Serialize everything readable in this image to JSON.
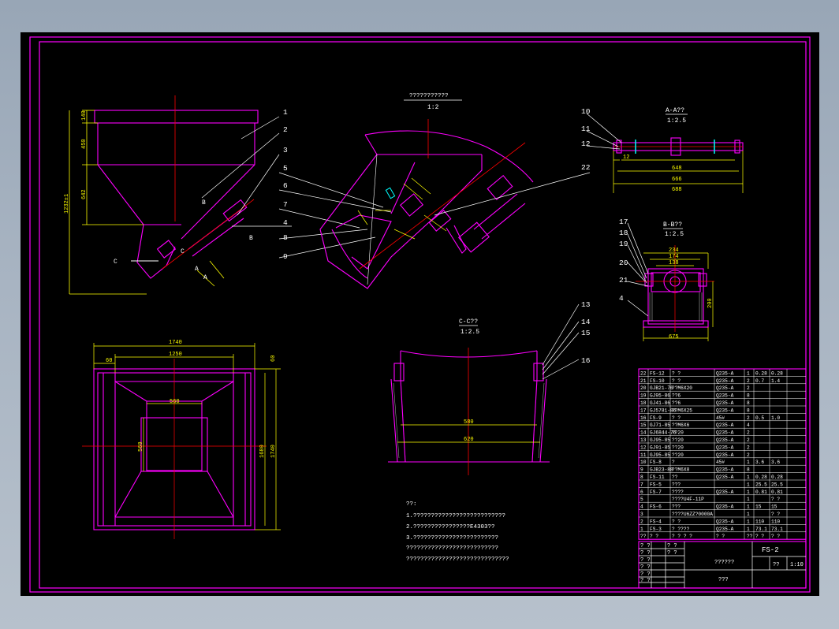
{
  "drawing": {
    "colors": {
      "frame": "#ff00ff",
      "outline": "#ff00ff",
      "dimension": "#ffff00",
      "centerline": "#ff0000",
      "hatch": "#ffffff",
      "text": "#ffffff",
      "accent": "#00ffff"
    },
    "views": {
      "main_title": "???????????",
      "main_scale": "1:2",
      "section_aa_title": "A-A??",
      "section_aa_scale": "1:2.5",
      "section_bb_title": "B-B??",
      "section_bb_scale": "1:2.5",
      "section_cc_title": "C-C??",
      "section_cc_scale": "1:2.5"
    },
    "dimensions": {
      "left_140": "140",
      "left_450": "450",
      "left_642": "642",
      "left_total": "1232±1",
      "aa_12": "12",
      "aa_648": "648",
      "aa_666": "666",
      "aa_688": "688",
      "bb_234": "234",
      "bb_174": "174",
      "bb_138": "138",
      "bb_200": "200",
      "bb_675": "675",
      "plan_1740_top": "1740",
      "plan_1250": "1250",
      "plan_60": "60",
      "plan_560a": "560",
      "plan_560b": "560",
      "plan_1680": "1680",
      "plan_1740_side": "1740",
      "plan_60_side": "60",
      "cc_580": "580",
      "cc_620": "620"
    },
    "balloons": {
      "left_side": [
        "1",
        "2",
        "3",
        "5",
        "6",
        "7",
        "4",
        "8",
        "9"
      ],
      "right_aa": [
        "10",
        "11",
        "12"
      ],
      "right_main": "22",
      "bb": [
        "17",
        "18",
        "19",
        "20",
        "21",
        "4"
      ],
      "cc": [
        "13",
        "14",
        "15",
        "16"
      ]
    },
    "view_letters": {
      "b_label": "B",
      "c_left": "C",
      "c_right": "C",
      "a_right": "A",
      "a_left": "A",
      "b_view": "B"
    },
    "notes": {
      "heading": "??:",
      "line1": "1.??????????????????????????",
      "line2": "2.????????????????E4303??",
      "line3": "3.????????????????????????",
      "line4": "??????????????????????????",
      "line5": "?????????????????????????????"
    },
    "bom_rows": [
      {
        "no": "22",
        "code": "FS-12",
        "name": "? ?",
        "mat": "Q235-A",
        "qty": "1",
        "w1": "0.28",
        "w2": "0.28"
      },
      {
        "no": "21",
        "code": "FS-10",
        "name": "? ?",
        "mat": "Q235-A",
        "qty": "2",
        "w1": "0.7",
        "w2": "1.4"
      },
      {
        "no": "20",
        "code": "GJB21-76",
        "name": "??M6X20",
        "mat": "Q235-A",
        "qty": "2",
        "w1": "",
        "w2": ""
      },
      {
        "no": "19",
        "code": "GJ95-86",
        "name": "??6",
        "mat": "Q235-A",
        "qty": "8",
        "w1": "",
        "w2": ""
      },
      {
        "no": "18",
        "code": "GJ41-86",
        "name": "??6",
        "mat": "Q235-A",
        "qty": "8",
        "w1": "",
        "w2": ""
      },
      {
        "no": "17",
        "code": "GJ5781-86",
        "name": "??M6X25",
        "mat": "Q235-A",
        "qty": "8",
        "w1": "",
        "w2": ""
      },
      {
        "no": "16",
        "code": "FS-9",
        "name": "? ?",
        "mat": "45#",
        "qty": "2",
        "w1": "0.5",
        "w2": "1.0"
      },
      {
        "no": "15",
        "code": "GJ71-85",
        "name": "??M6X6",
        "mat": "Q235-A",
        "qty": "4",
        "w1": "",
        "w2": ""
      },
      {
        "no": "14",
        "code": "GJ6844-76",
        "name": "??20",
        "mat": "Q235-A",
        "qty": "2",
        "w1": "",
        "w2": ""
      },
      {
        "no": "13",
        "code": "GJ95-85",
        "name": "??20",
        "mat": "Q235-A",
        "qty": "2",
        "w1": "",
        "w2": ""
      },
      {
        "no": "12",
        "code": "GJ91-85",
        "name": "??20",
        "mat": "Q235-A",
        "qty": "2",
        "w1": "",
        "w2": ""
      },
      {
        "no": "11",
        "code": "GJ95-85",
        "name": "??20",
        "mat": "Q235-A",
        "qty": "2",
        "w1": "",
        "w2": ""
      },
      {
        "no": "10",
        "code": "FS-8",
        "name": "?",
        "mat": "45#",
        "qty": "1",
        "w1": "3.6",
        "w2": "3.6"
      },
      {
        "no": "9",
        "code": "GJB23-88",
        "name": "??M6X8",
        "mat": "Q235-A",
        "qty": "8",
        "w1": "",
        "w2": ""
      },
      {
        "no": "8",
        "code": "FS-11",
        "name": "??",
        "mat": "Q235-A",
        "qty": "1",
        "w1": "0.28",
        "w2": "0.28"
      },
      {
        "no": "7",
        "code": "FS-5",
        "name": "???",
        "mat": "",
        "qty": "1",
        "w1": "25.5",
        "w2": "25.5"
      },
      {
        "no": "6",
        "code": "FS-7",
        "name": "????",
        "mat": "Q235-A",
        "qty": "1",
        "w1": "0.81",
        "w2": "0.81"
      },
      {
        "no": "5",
        "code": "",
        "name": "????U4F-11P",
        "mat": "",
        "qty": "1",
        "w1": "",
        "w2": "? ?"
      },
      {
        "no": "4",
        "code": "FS-6",
        "name": "???",
        "mat": "Q235-A",
        "qty": "1",
        "w1": "15",
        "w2": "15"
      },
      {
        "no": "3",
        "code": "",
        "name": "????U6ZZ?0000A",
        "mat": "",
        "qty": "1",
        "w1": "",
        "w2": "? ?"
      },
      {
        "no": "2",
        "code": "FS-4",
        "name": "? ?",
        "mat": "Q235-A",
        "qty": "1",
        "w1": "110",
        "w2": "110"
      },
      {
        "no": "1",
        "code": "FS-3",
        "name": "? ????",
        "mat": "Q235-A",
        "qty": "1",
        "w1": "73.1",
        "w2": "73.1"
      }
    ],
    "bom_header": {
      "no": "??",
      "code": "? ?",
      "name": "? ? ? ?",
      "mat": "? ?",
      "qty": "??",
      "w1": "? ?",
      "w2": "? ?"
    },
    "title_block": {
      "drawing_no": "FS-2",
      "title": "??????",
      "unit": "???",
      "scale_label": "1:10",
      "weight": "??",
      "cells": [
        "? ?",
        "? ?",
        "? ?",
        "? ?",
        "? ?",
        "? ?",
        "? ?",
        "? ?"
      ]
    }
  }
}
